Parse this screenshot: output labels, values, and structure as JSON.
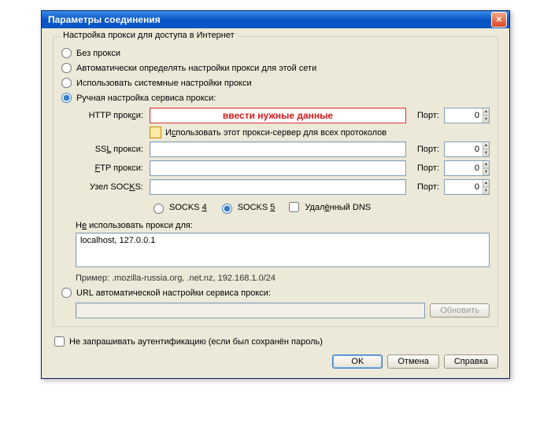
{
  "window": {
    "title": "Параметры соединения"
  },
  "group": {
    "title": "Настройка прокси для доступа в Интернет",
    "radio_no_proxy": "Без прокси",
    "radio_auto_detect": "Автоматически определять настройки прокси для этой сети",
    "radio_system": "Использовать системные настройки прокси",
    "radio_manual": "Ручная настройка сервиса прокси:",
    "http_label": "HTTP прокси:",
    "http_value": "ввести нужные данные",
    "port_label": "Порт:",
    "port_http": "0",
    "share_label": "Использовать этот прокси-сервер для всех протоколов",
    "ssl_label": "SSL прокси:",
    "ssl_value": "",
    "port_ssl": "0",
    "ftp_label": "FTP прокси:",
    "ftp_value": "",
    "port_ftp": "0",
    "socks_label": "Узел SOCKS:",
    "socks_value": "",
    "port_socks": "0",
    "socks4": "SOCKS 4",
    "socks5": "SOCKS 5",
    "remote_dns": "Удалённый DNS",
    "no_proxy_label": "Не использовать прокси для:",
    "no_proxy_value": "localhost, 127.0.0.1",
    "example": "Пример: .mozilla-russia.org, .net.nz, 192.168.1.0/24",
    "radio_pac": "URL автоматической настройки сервиса прокси:",
    "pac_value": "",
    "reload_btn": "Обновить"
  },
  "auth": {
    "label": "Не запрашивать аутентификацию (если был сохранён пароль)"
  },
  "footer": {
    "ok": "OK",
    "cancel": "Отмена",
    "help": "Справка"
  }
}
